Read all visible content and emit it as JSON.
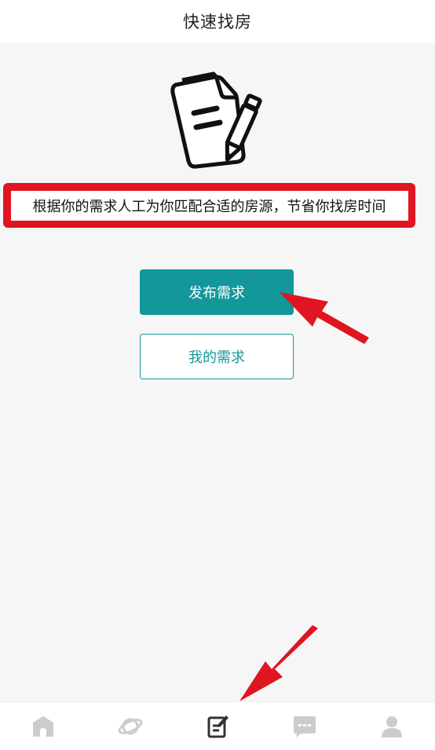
{
  "header": {
    "title": "快速找房"
  },
  "illustration": {
    "icon": "document-pencil-icon"
  },
  "description": {
    "text": "根据你的需求人工为你匹配合适的房源，节省你找房时间",
    "highlight_color": "#e01522"
  },
  "actions": {
    "publish_label": "发布需求",
    "my_requests_label": "我的需求"
  },
  "colors": {
    "accent": "#13979a",
    "tab_inactive": "#cccccc",
    "tab_active": "#333333"
  },
  "tabbar": {
    "items": [
      {
        "icon": "home-icon",
        "active": false
      },
      {
        "icon": "planet-icon",
        "active": false
      },
      {
        "icon": "edit-document-icon",
        "active": true
      },
      {
        "icon": "chat-icon",
        "active": false
      },
      {
        "icon": "user-icon",
        "active": false
      }
    ]
  }
}
